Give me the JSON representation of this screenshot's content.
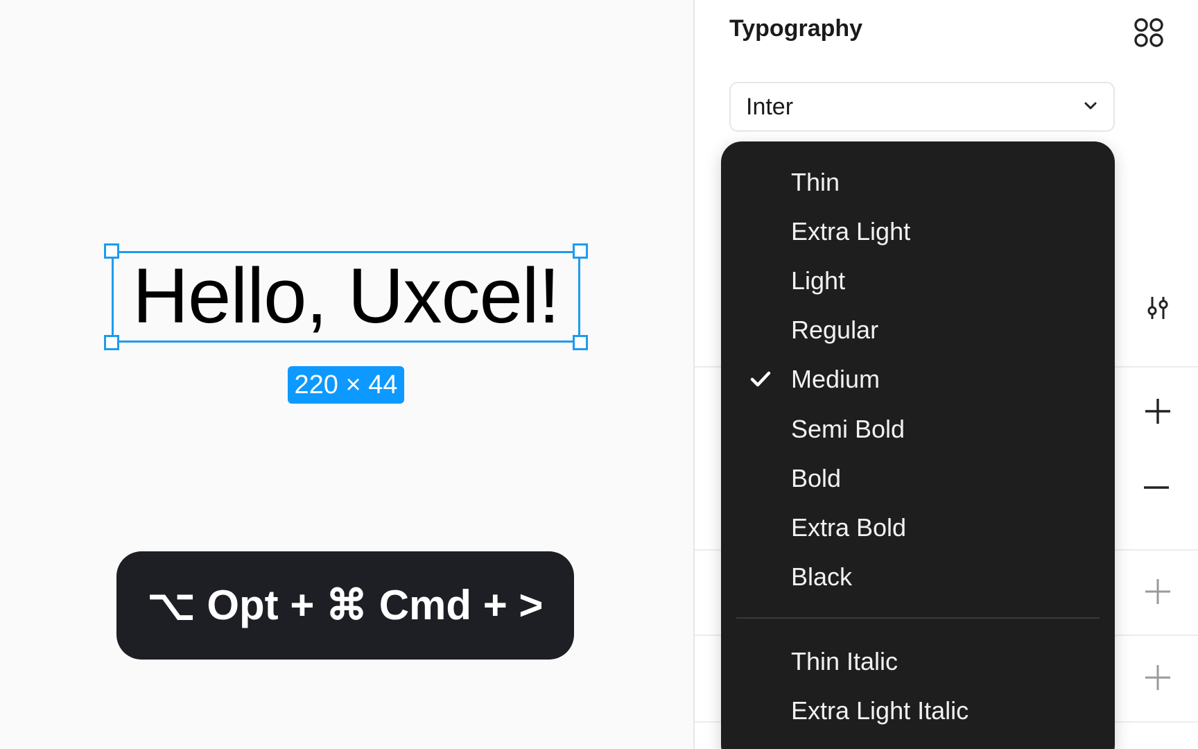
{
  "canvas": {
    "selected_text": "Hello, Uxcel!",
    "size_badge": "220 × 44",
    "shortcut_hint": "⌥ Opt + ⌘ Cmd + >"
  },
  "panel": {
    "title": "Typography",
    "font_family": {
      "value": "Inter"
    }
  },
  "font_weight_menu": {
    "selected": "Medium",
    "items": [
      {
        "label": "Thin"
      },
      {
        "label": "Extra Light"
      },
      {
        "label": "Light"
      },
      {
        "label": "Regular"
      },
      {
        "label": "Medium"
      },
      {
        "label": "Semi Bold"
      },
      {
        "label": "Bold"
      },
      {
        "label": "Extra Bold"
      },
      {
        "label": "Black"
      },
      {
        "label": "Thin Italic"
      },
      {
        "label": "Extra Light Italic"
      }
    ]
  },
  "colors": {
    "selection": "#1d9bf0",
    "badge": "#0d99ff",
    "menu_bg": "#1e1e1e",
    "shortcut_bg": "#1e1f24"
  },
  "icons": {
    "panel_header": "styles-grid-icon",
    "chevron": "chevron-down-icon",
    "side_controls": [
      "sliders-icon",
      "plus-icon",
      "minus-icon",
      "plus-icon",
      "plus-icon"
    ],
    "selected_mark": "checkmark-icon"
  }
}
